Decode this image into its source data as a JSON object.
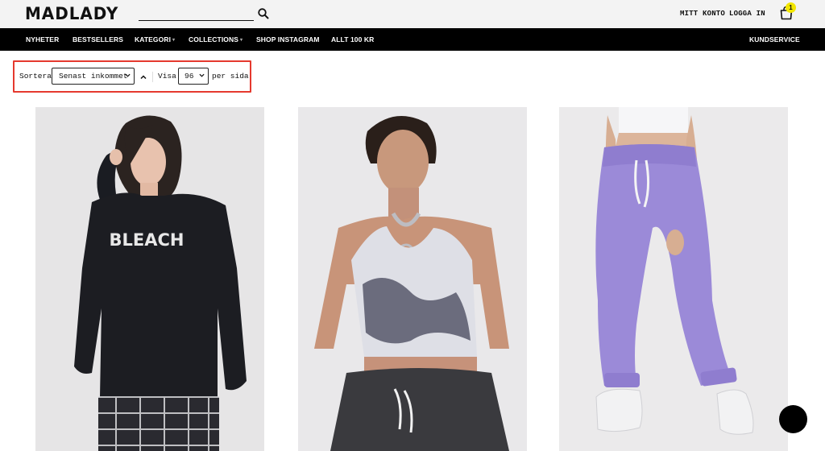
{
  "header": {
    "logo": "MADLADY",
    "search_placeholder": "",
    "account_label": "MITT KONTO",
    "login_label": "LOGGA IN",
    "cart_count": "1",
    "badge_color": "#f2e600"
  },
  "nav": {
    "items": [
      {
        "label": "NYHETER",
        "dropdown": false
      },
      {
        "label": "BESTSELLERS",
        "dropdown": false
      },
      {
        "label": "KATEGORI",
        "dropdown": true
      },
      {
        "label": "COLLECTIONS",
        "dropdown": true
      },
      {
        "label": "SHOP INSTAGRAM",
        "dropdown": false
      },
      {
        "label": "ALLT 100 KR",
        "dropdown": false
      }
    ],
    "service_label": "KUNDSERVICE"
  },
  "toolbar": {
    "sort_label": "Sortera",
    "sort_value": "Senast inkommet",
    "show_label": "Visa",
    "show_value": "96",
    "per_page_label": "per sida",
    "highlight_color": "#e5392e"
  },
  "products": [
    {
      "garment": "black sweatshirt with BLEACH print",
      "print_text": "BLEACH"
    },
    {
      "garment": "tie-dye crop top"
    },
    {
      "garment": "lilac sweatpants"
    }
  ],
  "icons": [
    "search-icon",
    "cart-icon",
    "caret-down-icon",
    "sort-direction-icon",
    "chat-icon"
  ]
}
